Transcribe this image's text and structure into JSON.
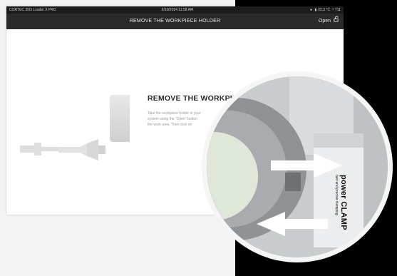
{
  "status_bar": {
    "device": "CORTEC 350i Loader X PRO",
    "datetime": "6/10/2024 11:58 AM",
    "temperature": "22,3 °C",
    "extra": "T11"
  },
  "header": {
    "title": "REMOVE THE WORKPIECE HOLDER",
    "open_label": "Open"
  },
  "content": {
    "heading": "REMOVE THE WORKPIECE",
    "body_lines": [
      "Take the workpiece holder in your",
      "system using the \"Open\" button",
      "the work area. Then click on"
    ]
  },
  "zoom": {
    "brand": "power CLAMP",
    "tagline": "fast and precise clamping"
  },
  "colors": {
    "header_bg": "#2a2a2a",
    "status_bg": "#1c1c1c",
    "panel_bg": "#ffffff",
    "page_bg": "#f3f3f3"
  }
}
